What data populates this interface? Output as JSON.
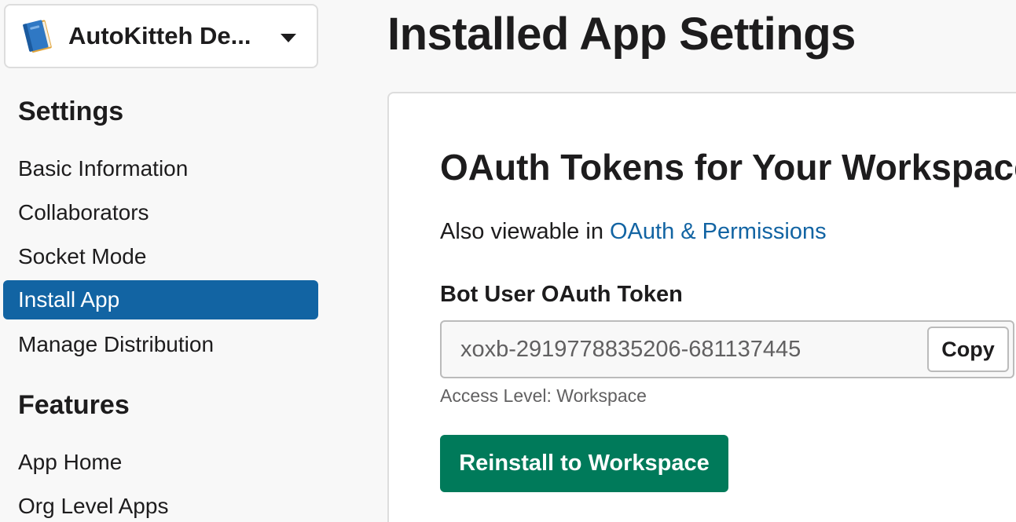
{
  "sidebar": {
    "app_switcher": {
      "app_name": "AutoKitteh De...",
      "icon": "blue-book-icon",
      "caret_icon": "caret-down-icon"
    },
    "sections": [
      {
        "title": "Settings",
        "items": [
          {
            "label": "Basic Information",
            "active": false
          },
          {
            "label": "Collaborators",
            "active": false
          },
          {
            "label": "Socket Mode",
            "active": false
          },
          {
            "label": "Install App",
            "active": true
          },
          {
            "label": "Manage Distribution",
            "active": false
          }
        ]
      },
      {
        "title": "Features",
        "items": [
          {
            "label": "App Home",
            "active": false
          },
          {
            "label": "Org Level Apps",
            "active": false
          }
        ]
      }
    ]
  },
  "main": {
    "page_title": "Installed App Settings",
    "card": {
      "heading": "OAuth Tokens for Your Workspace",
      "viewable_prefix": "Also viewable in ",
      "viewable_link": "OAuth & Permissions",
      "token_label": "Bot User OAuth Token",
      "token_value": "xoxb-2919778835206-681137445",
      "copy_label": "Copy",
      "access_level": "Access Level: Workspace",
      "reinstall_label": "Reinstall to Workspace"
    }
  },
  "colors": {
    "accent": "#1264a3",
    "primary_button": "#007a5a",
    "background": "#f8f8f8"
  }
}
